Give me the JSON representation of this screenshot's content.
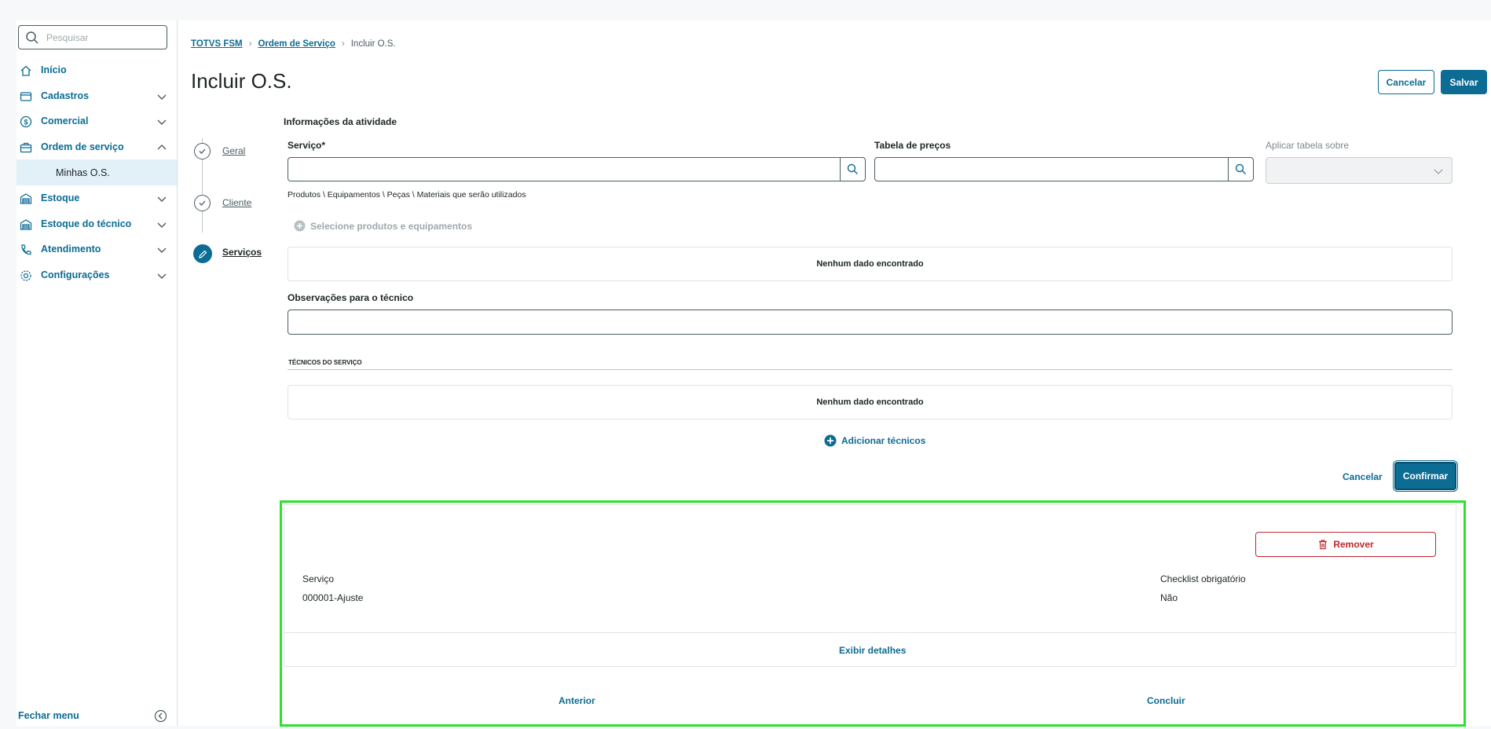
{
  "search": {
    "placeholder": "Pesquisar"
  },
  "sidebar": {
    "items": [
      {
        "label": "Início"
      },
      {
        "label": "Cadastros"
      },
      {
        "label": "Comercial"
      },
      {
        "label": "Ordem de serviço"
      },
      {
        "label": "Minhas O.S."
      },
      {
        "label": "Estoque"
      },
      {
        "label": "Estoque do técnico"
      },
      {
        "label": "Atendimento"
      },
      {
        "label": "Configurações"
      }
    ],
    "close_label": "Fechar menu"
  },
  "breadcrumb": {
    "items": [
      "TOTVS FSM",
      "Ordem de Serviço",
      "Incluir O.S."
    ]
  },
  "page": {
    "title": "Incluir O.S.",
    "cancel_label": "Cancelar",
    "save_label": "Salvar"
  },
  "stepper": {
    "steps": [
      "Geral",
      "Cliente",
      "Serviços"
    ]
  },
  "activity": {
    "section_title": "Informações da atividade",
    "service_label": "Serviço*",
    "price_table_label": "Tabela de preços",
    "apply_table_label": "Aplicar tabela sobre",
    "products_hint": "Produtos \\ Equipamentos \\ Peças \\ Materiais que serão utilizados",
    "select_products": "Selecione produtos e equipamentos",
    "no_data_1": "Nenhum dado encontrado",
    "observations_label": "Observações para o técnico",
    "technicians_divider": "TÉCNICOS DO SERVIÇO",
    "no_data_2": "Nenhum dado encontrado",
    "add_technicians": "Adicionar técnicos",
    "cancel_label": "Cancelar",
    "confirm_label": "Confirmar"
  },
  "service_card": {
    "remove_label": "Remover",
    "service_key": "Serviço",
    "service_value": "000001-Ajuste",
    "checklist_key": "Checklist obrigatório",
    "checklist_value": "Não",
    "details_label": "Exibir detalhes"
  },
  "footer": {
    "previous_label": "Anterior",
    "finish_label": "Concluir"
  },
  "colors": {
    "primary": "#0c6c94",
    "danger": "#c0262e",
    "highlight": "#2fe02f"
  }
}
